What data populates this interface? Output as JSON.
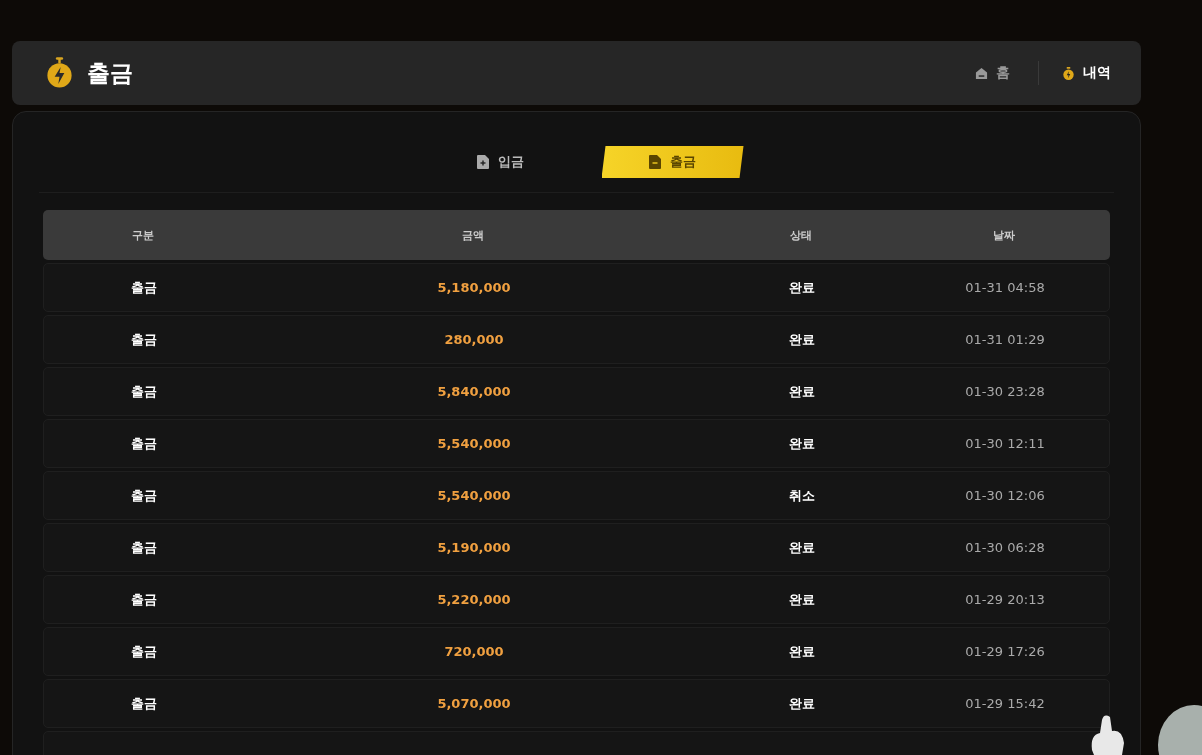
{
  "header": {
    "title": "출금",
    "nav": [
      {
        "label": "홈",
        "kind": "home",
        "selected": false
      },
      {
        "label": "내역",
        "kind": "history",
        "selected": true
      }
    ]
  },
  "tabs": [
    {
      "label": "입금",
      "kind": "deposit",
      "selected": false
    },
    {
      "label": "출금",
      "kind": "withdraw",
      "selected": true
    }
  ],
  "table": {
    "columns": [
      "구분",
      "금액",
      "상태",
      "날짜"
    ],
    "rows": [
      {
        "type": "출금",
        "amount": "5,180,000",
        "status": "완료",
        "date": "01-31 04:58"
      },
      {
        "type": "출금",
        "amount": "280,000",
        "status": "완료",
        "date": "01-31 01:29"
      },
      {
        "type": "출금",
        "amount": "5,840,000",
        "status": "완료",
        "date": "01-30 23:28"
      },
      {
        "type": "출금",
        "amount": "5,540,000",
        "status": "완료",
        "date": "01-30 12:11"
      },
      {
        "type": "출금",
        "amount": "5,540,000",
        "status": "취소",
        "date": "01-30 12:06"
      },
      {
        "type": "출금",
        "amount": "5,190,000",
        "status": "완료",
        "date": "01-30 06:28"
      },
      {
        "type": "출금",
        "amount": "5,220,000",
        "status": "완료",
        "date": "01-29 20:13"
      },
      {
        "type": "출금",
        "amount": "720,000",
        "status": "완료",
        "date": "01-29 17:26"
      },
      {
        "type": "출금",
        "amount": "5,070,000",
        "status": "완료",
        "date": "01-29 15:42"
      }
    ]
  }
}
